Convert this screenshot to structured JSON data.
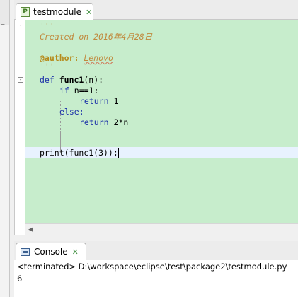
{
  "editor": {
    "tab_label": "testmodule",
    "file_icon_letter": "P",
    "close_glyph": "✕",
    "code": {
      "doc_open": "'''",
      "created": "Created on 2016年4月28日",
      "author_tag": "@author:",
      "author_name": "Lenovo",
      "doc_close": "'''",
      "l_def_kw": "def",
      "l_def_name": "func1",
      "l_def_rest": "(n):",
      "l_if_kw": "if",
      "l_if_rest": " n==1:",
      "l_ret1_kw": "return",
      "l_ret1_rest": " 1",
      "l_else_kw": "else:",
      "l_ret2_kw": "return",
      "l_ret2_rest": " 2*n",
      "l_print": "print(func1(3));"
    },
    "scroll_arrow": "◀"
  },
  "console": {
    "tab_label": "Console",
    "close_glyph": "✕",
    "terminated_line": "<terminated> D:\\workspace\\eclipse\\test\\package2\\testmodule.py",
    "output": "6"
  },
  "icons": {
    "file_icon": "python-file-icon",
    "console_icon": "console-icon"
  },
  "colors": {
    "editor_bg": "#c7edcc",
    "keyword": "#1a2fa8",
    "docstring": "#c08a3e",
    "current_line": "#e8f2fe"
  }
}
